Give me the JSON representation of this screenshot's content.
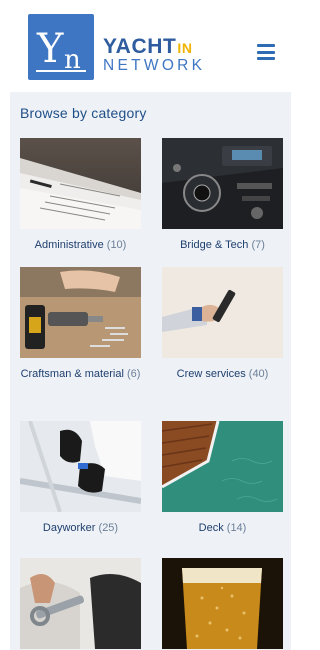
{
  "brand": {
    "logo_letter": "Yn",
    "name_main": "YACHT",
    "name_suffix": "IN",
    "name_sub": "NETWORK",
    "primary_color": "#3f76c3",
    "accent_color": "#f0b400"
  },
  "header": {
    "menu_icon": "hamburger-menu-icon"
  },
  "browse": {
    "title": "Browse by category",
    "categories": [
      {
        "name": "Administrative",
        "count": "(10)"
      },
      {
        "name": "Bridge & Tech",
        "count": "(7)"
      },
      {
        "name": "Craftsman & material",
        "count": "(6)"
      },
      {
        "name": "Crew services",
        "count": "(40)"
      },
      {
        "name": "Dayworker",
        "count": "(25)"
      },
      {
        "name": "Deck",
        "count": "(14)"
      },
      {
        "name": "",
        "count": ""
      },
      {
        "name": "",
        "count": ""
      }
    ]
  }
}
